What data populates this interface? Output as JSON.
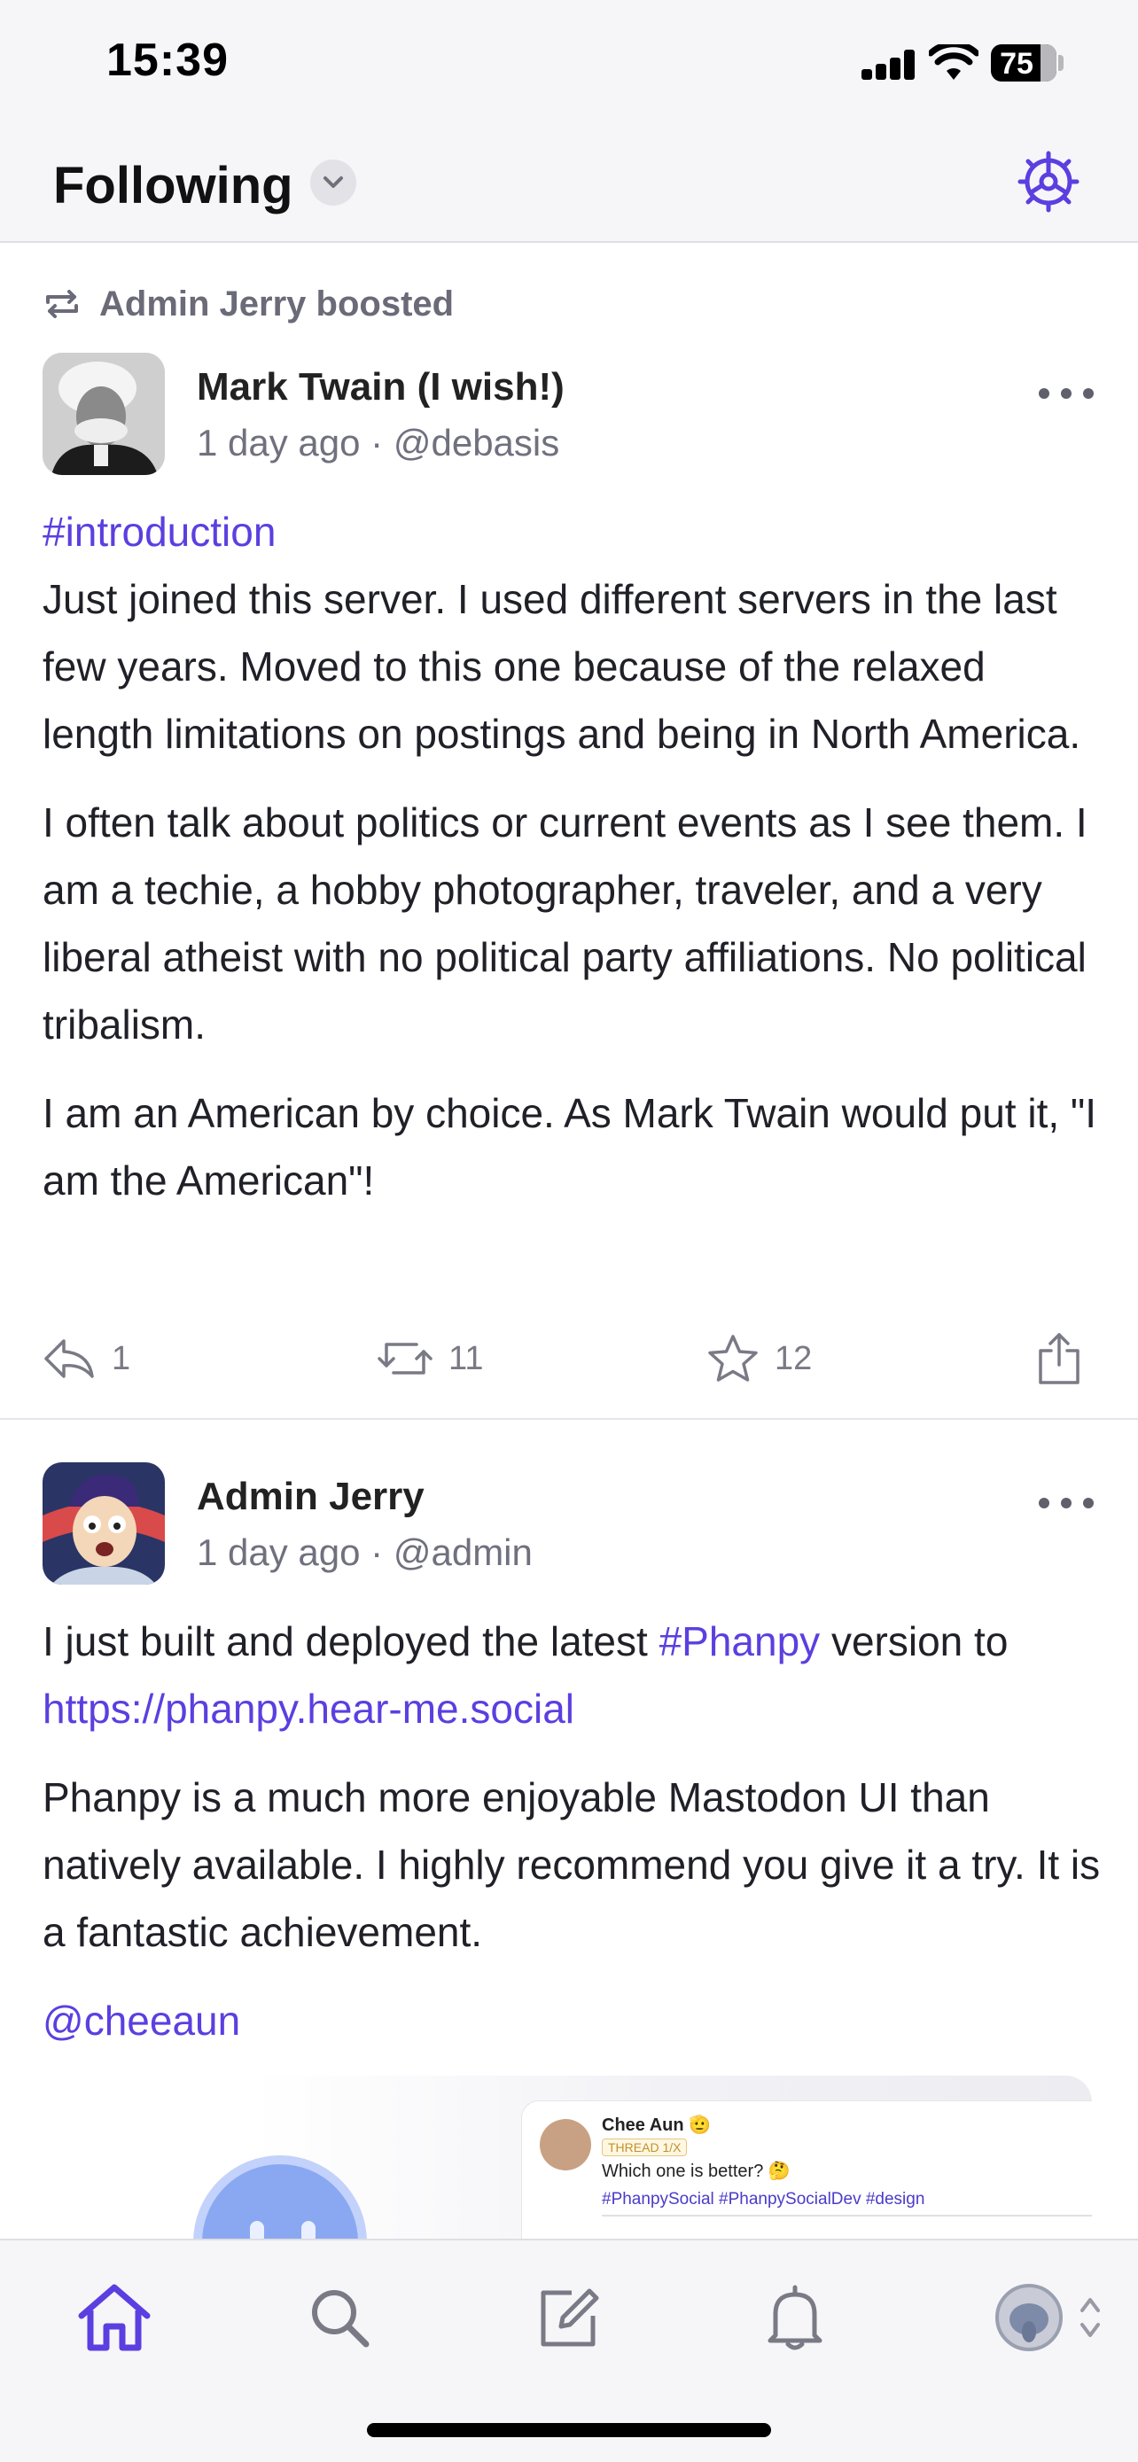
{
  "status_bar": {
    "time": "15:39",
    "battery": "75",
    "battery_level": 0.75
  },
  "header": {
    "title": "Following"
  },
  "posts": [
    {
      "boost_label": "Admin Jerry boosted",
      "author": "Mark Twain (I wish!)",
      "time": "1 day ago",
      "separator": "·",
      "handle": "@debasis",
      "hashtag": "#introduction",
      "paragraphs": [
        "Just joined this server. I used different servers in the last few years. Moved to this one because of the relaxed length limitations on postings and being in North America.",
        "I often talk about politics or current events as I see them. I am a techie, a hobby photographer, traveler, and a very liberal atheist with no political party affiliations. No political tribalism.",
        "I am an American by choice. As Mark Twain would put it, \"I am the American\"!"
      ],
      "replies": "1",
      "boosts": "11",
      "favourites": "12"
    },
    {
      "author": "Admin Jerry",
      "time": "1 day ago",
      "separator": "·",
      "handle": "@admin",
      "p1_before": "I just built and deployed the latest ",
      "p1_hashtag": "#Phanpy",
      "p1_middle": " version to ",
      "p1_link": "https://phanpy.hear-me.social",
      "p2": "Phanpy is a much more enjoyable Mastodon UI than natively available. I highly recommend you give it a try. It is a fantastic achievement.",
      "mention": "@cheeaun",
      "preview": {
        "name": "Chee Aun 🫡",
        "badge": "THREAD 1/X",
        "text": "Which one is better? 🤔",
        "tags": "#PhanpySocial #PhanpySocialDev #design"
      }
    }
  ],
  "colors": {
    "accent": "#5b3fe0",
    "muted": "#70707e",
    "background": "#ffffff",
    "bar": "#f6f6f8"
  },
  "tabbar": {
    "icons": [
      "home-icon",
      "search-icon",
      "compose-icon",
      "bell-icon",
      "account-avatar"
    ]
  }
}
